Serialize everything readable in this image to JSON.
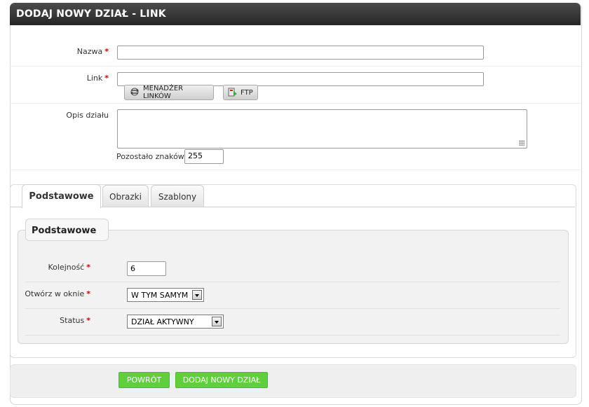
{
  "header": {
    "title": "DODAJ NOWY DZIAŁ - LINK"
  },
  "form": {
    "name_label": "Nazwa",
    "name_value": "",
    "link_label": "Link",
    "link_value": "",
    "link_manager_button": "MENADŻER LINKÓW",
    "ftp_button": "FTP",
    "description_label": "Opis działu",
    "description_value": "",
    "remaining_label": "Pozostało znaków :",
    "remaining_value": "255",
    "required_mark": "*"
  },
  "tabs": [
    {
      "label": "Podstawowe",
      "active": true
    },
    {
      "label": "Obrazki",
      "active": false
    },
    {
      "label": "Szablony",
      "active": false
    }
  ],
  "basic": {
    "legend": "Podstawowe",
    "order_label": "Kolejność",
    "order_value": "6",
    "open_label": "Otwórz w oknie",
    "open_value": "W TYM SAMYM",
    "status_label": "Status",
    "status_value": "DZIAŁ AKTYWNY"
  },
  "footer": {
    "back_button": "POWRÓT",
    "add_button": "DODAJ NOWY DZIAŁ"
  },
  "icons": {
    "link_manager": "link-manager-icon",
    "ftp": "ftp-icon"
  },
  "colors": {
    "header_bg": "#333333",
    "required": "#cc0000",
    "action_green": "#5fcf3c"
  }
}
